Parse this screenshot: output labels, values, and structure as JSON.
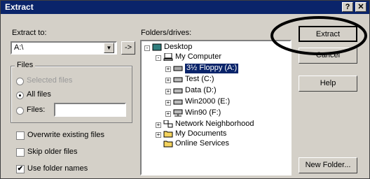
{
  "window": {
    "title": "Extract",
    "help_glyph": "?",
    "close_glyph": "✕"
  },
  "extract_to": {
    "label": "Extract to:",
    "value": "A:\\",
    "dropdown_glyph": "▼",
    "arrow_label": "->"
  },
  "files_group": {
    "title": "Files",
    "options": [
      {
        "label": "Selected files",
        "selected": false,
        "enabled": false
      },
      {
        "label": "All files",
        "selected": true,
        "enabled": true
      },
      {
        "label": "Files:",
        "selected": false,
        "enabled": true
      }
    ],
    "files_value": ""
  },
  "checkboxes": [
    {
      "label": "Overwrite existing files",
      "checked": false
    },
    {
      "label": "Skip older files",
      "checked": false
    },
    {
      "label": "Use folder names",
      "checked": true
    }
  ],
  "folders": {
    "label": "Folders/drives:",
    "tree": [
      {
        "label": "Desktop",
        "level": 0,
        "expander": "-",
        "icon": "desktop-icon"
      },
      {
        "label": "My Computer",
        "level": 1,
        "expander": "-",
        "icon": "computer-icon"
      },
      {
        "label": "3½ Floppy (A:)",
        "level": 2,
        "expander": "+",
        "icon": "floppy-icon",
        "selected": true
      },
      {
        "label": "Test (C:)",
        "level": 2,
        "expander": "+",
        "icon": "drive-icon"
      },
      {
        "label": "Data (D:)",
        "level": 2,
        "expander": "+",
        "icon": "drive-icon"
      },
      {
        "label": "Win2000 (E:)",
        "level": 2,
        "expander": "+",
        "icon": "drive-icon"
      },
      {
        "label": "Win90 (F:)",
        "level": 2,
        "expander": "+",
        "icon": "network-drive-icon"
      },
      {
        "label": "Network Neighborhood",
        "level": 1,
        "expander": "+",
        "icon": "network-icon"
      },
      {
        "label": "My Documents",
        "level": 1,
        "expander": "+",
        "icon": "folder-icon"
      },
      {
        "label": "Online Services",
        "level": 1,
        "expander": "",
        "icon": "folder-icon"
      }
    ]
  },
  "buttons": {
    "extract": "Extract",
    "cancel": "Cancel",
    "help": "Help",
    "new_folder": "New Folder..."
  },
  "colors": {
    "titlebar": "#0a246a",
    "face": "#d4d0c8",
    "selection": "#0a246a"
  }
}
